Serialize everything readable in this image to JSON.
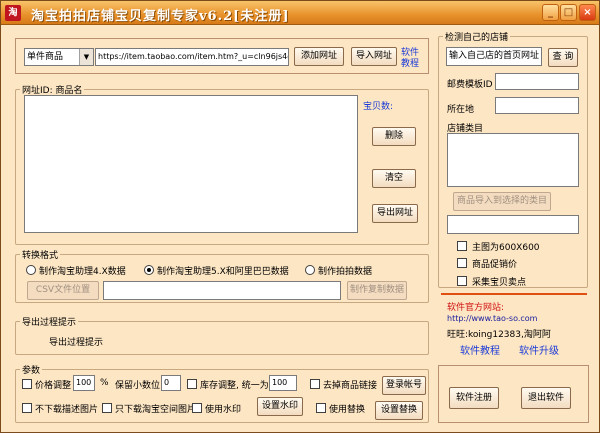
{
  "window": {
    "title": "淘宝拍拍店铺宝贝复制专家v6.2[未注册]",
    "icon_text": "淘"
  },
  "top": {
    "type_select": "单件商品",
    "url_value": "https://item.taobao.com/item.htm?_u=cln96js4df",
    "add_url": "添加网址",
    "import_url": "导入网址",
    "tutorial_line1": "软件",
    "tutorial_line2": "教程"
  },
  "urlbox": {
    "legend": "网址ID: 商品名",
    "count_label": "宝贝数:",
    "delete": "删除",
    "clear": "清空",
    "export": "导出网址"
  },
  "convert": {
    "legend": "转换格式",
    "opt1": "制作淘宝助理4.X数据",
    "opt2": "制作淘宝助理5.X和阿里巴巴数据",
    "opt3": "制作拍拍数据",
    "csv_btn": "CSV文件位置",
    "make_btn": "制作复制数据"
  },
  "export_box": {
    "legend": "导出过程提示",
    "text": "导出过程提示"
  },
  "params": {
    "legend": "参数",
    "price_adjust": "价格调整",
    "price_value": "100",
    "percent": "%",
    "decimal_label": "保留小数位",
    "decimal_value": "0",
    "stock_adjust": "库存调整, 统一为",
    "stock_value": "100",
    "remove_links": "去掉商品链接",
    "login_btn": "登录帐号",
    "no_desc_img": "不下载描述图片",
    "only_space_img": "只下载淘宝空间图片",
    "use_watermark": "使用水印",
    "set_watermark": "设置水印",
    "use_replace": "使用替换",
    "set_replace": "设置替换"
  },
  "shop": {
    "legend": "检测自己的店铺",
    "shop_input": "输入自己店的首页网址",
    "query": "查 询",
    "postage_label": "邮费模板ID",
    "location_label": "所在地",
    "category_label": "店铺类目",
    "import_category": "商品导入到选择的类目",
    "main_pic": "主图为600X600",
    "promo_price": "商品促销价",
    "collect_points": "采集宝贝卖点"
  },
  "official": {
    "site_label": "软件官方网站:",
    "url": "http://www.tao-so.com",
    "wangwang": "旺旺:koing12383,淘阿阿",
    "tutorial": "软件教程",
    "upgrade": "软件升级"
  },
  "bottom": {
    "register": "软件注册",
    "exit": "退出软件"
  }
}
